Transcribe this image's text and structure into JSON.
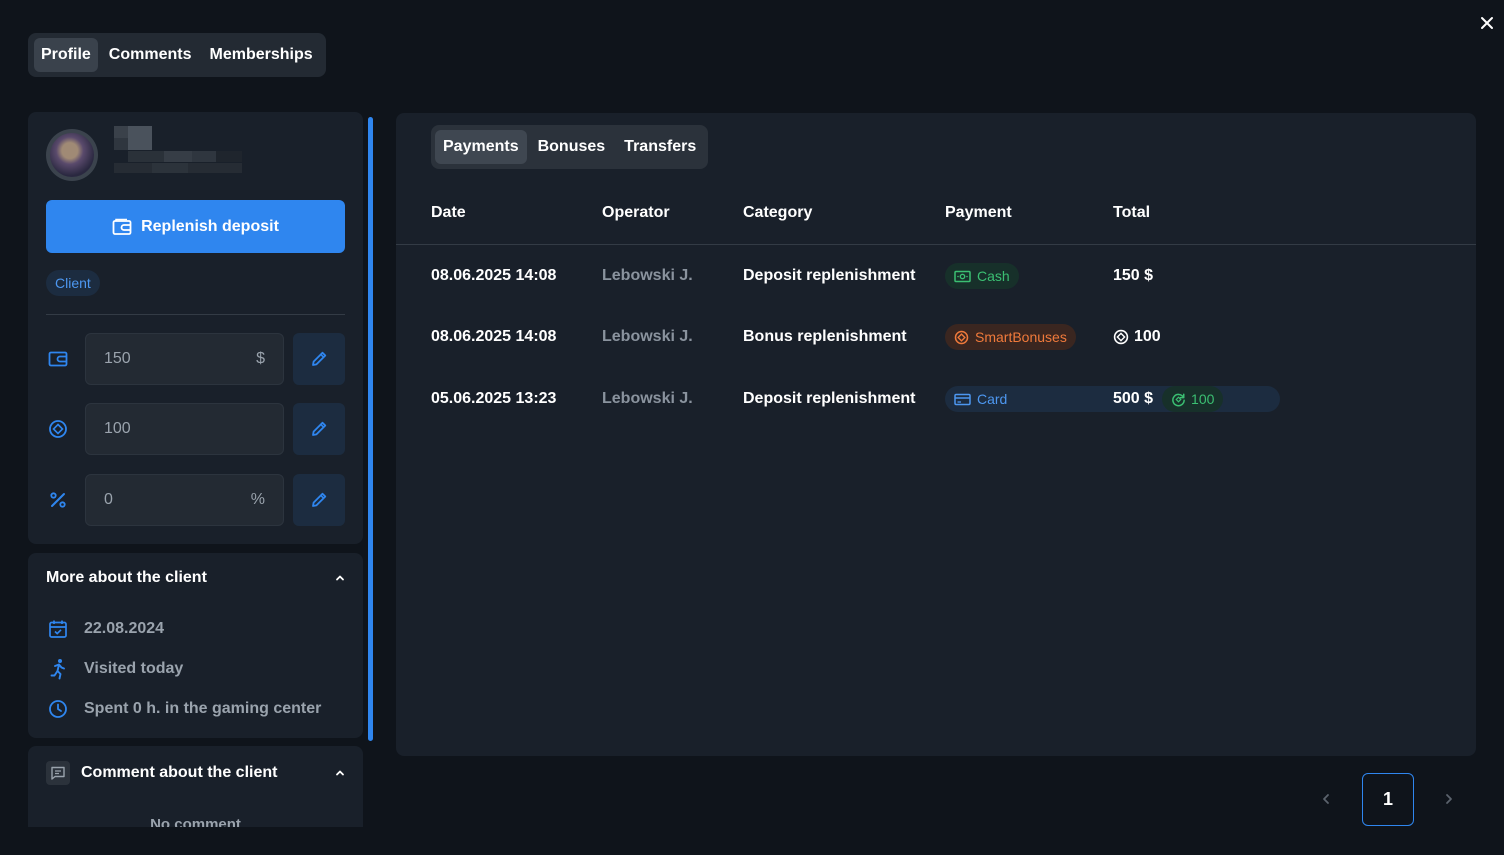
{
  "top_tabs": [
    {
      "label": "Profile",
      "active": true
    },
    {
      "label": "Comments",
      "active": false
    },
    {
      "label": "Memberships",
      "active": false
    }
  ],
  "profile": {
    "replenish_label": "Replenish deposit",
    "role_badge": "Client",
    "deposit_value": "150",
    "deposit_unit": "$",
    "bonus_value": "100",
    "discount_value": "0",
    "discount_unit": "%"
  },
  "more_about": {
    "title": "More about the client",
    "date": "22.08.2024",
    "visited": "Visited today",
    "spent": "Spent 0 h. in the gaming center"
  },
  "comment": {
    "title": "Comment about the client",
    "empty_text": "No comment"
  },
  "sub_tabs": [
    {
      "label": "Payments",
      "active": true
    },
    {
      "label": "Bonuses",
      "active": false
    },
    {
      "label": "Transfers",
      "active": false
    }
  ],
  "table": {
    "headers": {
      "date": "Date",
      "operator": "Operator",
      "category": "Category",
      "payment": "Payment",
      "total": "Total"
    },
    "rows": [
      {
        "date": "08.06.2025 14:08",
        "operator": "Lebowski J.",
        "category": "Deposit replenishment",
        "payment": "Cash",
        "payment_icon": "cash-icon",
        "total": "150 $",
        "total_icon": "",
        "bonus": ""
      },
      {
        "date": "08.06.2025 14:08",
        "operator": "Lebowski J.",
        "category": "Bonus replenishment",
        "payment": "SmartBonuses",
        "payment_icon": "smartbonus-icon",
        "total": "100",
        "total_icon": "bonus-coin-icon",
        "bonus": ""
      },
      {
        "date": "05.06.2025 13:23",
        "operator": "Lebowski J.",
        "category": "Deposit replenishment",
        "payment": "Card",
        "payment_icon": "card-icon",
        "total": "500 $",
        "total_icon": "",
        "bonus": "100"
      }
    ]
  },
  "pagination": {
    "current_page": "1"
  },
  "colors": {
    "background": "#0f141b",
    "panel": "#19202a",
    "accent": "#2f86ef",
    "cash_green": "#3bbf72",
    "smart_orange": "#f07a3b"
  }
}
